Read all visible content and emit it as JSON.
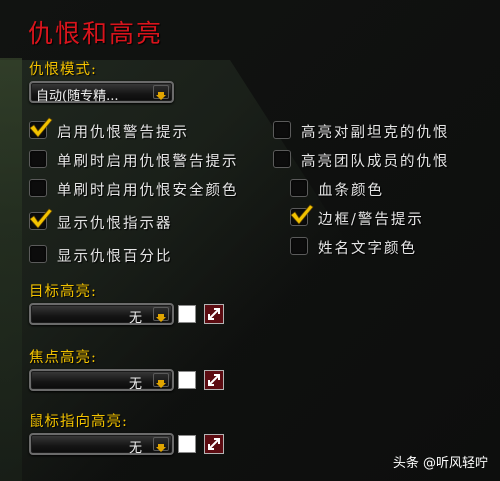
{
  "title": "仇恨和高亮",
  "threat_mode": {
    "label": "仇恨模式:",
    "selected": "自动(随专精..."
  },
  "left_options": [
    {
      "label": "启用仇恨警告提示",
      "checked": true
    },
    {
      "label": "单刷时启用仇恨警告提示",
      "checked": false
    },
    {
      "label": "单刷时启用仇恨安全颜色",
      "checked": false
    },
    {
      "label": "显示仇恨指示器",
      "checked": true
    },
    {
      "label": "显示仇恨百分比",
      "checked": false
    }
  ],
  "right_options": [
    {
      "label": "高亮对副坦克的仇恨",
      "checked": false
    },
    {
      "label": "高亮团队成员的仇恨",
      "checked": false
    }
  ],
  "right_sub_options": [
    {
      "label": "血条颜色",
      "checked": false
    },
    {
      "label": "边框/警告提示",
      "checked": true
    },
    {
      "label": "姓名文字颜色",
      "checked": false
    }
  ],
  "highlights": [
    {
      "label": "目标高亮:",
      "selected": "无"
    },
    {
      "label": "焦点高亮:",
      "selected": "无"
    },
    {
      "label": "鼠标指向高亮:",
      "selected": "无"
    }
  ],
  "colors": {
    "title": "#d9141c",
    "section": "#f2c200",
    "check": "#f2c200"
  },
  "icons": {
    "dropdown": "arrow-down-icon",
    "check": "checkmark-icon",
    "expand": "expand-arrows-icon"
  },
  "watermark": "头条 @听风轻咛"
}
